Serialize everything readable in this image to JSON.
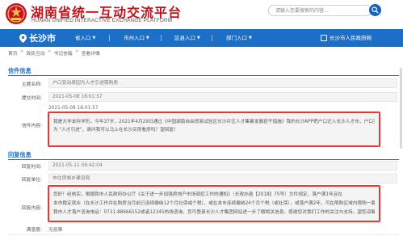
{
  "site": {
    "title": "湖南省统一互动交流平台",
    "subtitle": "HUNAN UNIFIED INTERACTIVE EXCHANGE PLATFORM",
    "search_placeholder": "请输入您要搜索的内容..."
  },
  "nav": {
    "city": "长沙市",
    "items": [
      {
        "label": "省入口"
      },
      {
        "label": "市州入口"
      },
      {
        "label": "区县入口"
      },
      {
        "label": "部门入口"
      }
    ],
    "right_link": "长沙市人民政府网"
  },
  "breadcrumb": [
    "首页",
    "政民互动",
    "书记信箱",
    "查看详情"
  ],
  "letter": {
    "section_title": "信件信息",
    "fields": [
      {
        "label": "主题名称:",
        "value": "户口变动原因为人才引进需购房"
      },
      {
        "label": "提交时间:",
        "value": "2021-05-08 16:01:57"
      }
    ],
    "content_label": "信件内容:",
    "content_header": "2021-05-08 16:01:57",
    "content_lines": [
      "我是大学本科学历，今年37岁，2021年4月29日通过《中国湖南自由贸易试验区长沙片区人才集聚发展若干措施》我的长沙APP把户口迁入长沙人才市，户口变动原因",
      "为 \"人才引进\"，请问我可以马上在长沙买房看房吗？望回复!"
    ]
  },
  "reply": {
    "section_title": "回复信息",
    "fields": [
      {
        "label": "回复时间:",
        "value": "2021-05-11 09:42:04"
      },
      {
        "label": "回复单位:",
        "value": "市住房城乡建设局"
      }
    ],
    "content_label": "回复内容:",
    "content_lines": [
      "您好！经核实，根据我市人民政府办公厅《关于进一步加强房地产市场调控工作的通知》（长政办函【2018】75号）文件规定，落户满1年且在",
      "本市稳定就业（在长沙工作并在购房当月前已连续缴纳12个月社保或个税），或在本市连续缴纳24个月个税（或社保），或落户满2年，可在限购区域内限购一套商品住房。",
      "我市人才落户咨询电话：0731-88666152或者12345热线咨询，您可登录长沙人才集团网站进一步了解相关信息。感谢您对我们工作的关注与支持，望您谅解!"
    ],
    "rating_label": "满意度:",
    "rating_value": "无投票"
  },
  "colors": {
    "brand_red": "#c0141b",
    "nav_blue": "#1b6fc6",
    "highlight_border": "#e53935"
  },
  "icons": [
    "national-emblem-icon",
    "search-icon",
    "location-pin-icon",
    "caret-down-icon",
    "government-site-icon"
  ]
}
